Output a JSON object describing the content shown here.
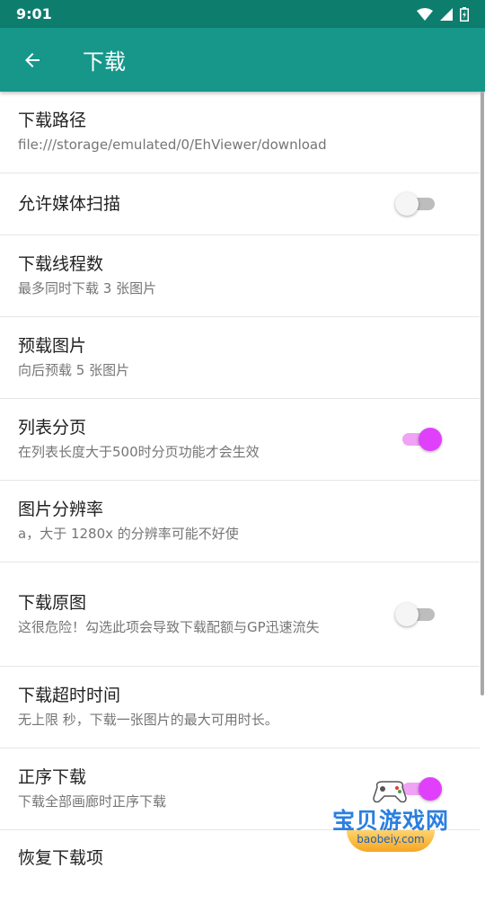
{
  "status_bar": {
    "time": "9:01"
  },
  "app_bar": {
    "title": "下载"
  },
  "settings": [
    {
      "title": "下载路径",
      "subtitle": "file:///storage/emulated/0/EhViewer/download"
    },
    {
      "title": "允许媒体扫描",
      "switch": "off"
    },
    {
      "title": "下载线程数",
      "subtitle": "最多同时下载 3 张图片"
    },
    {
      "title": "预载图片",
      "subtitle": "向后预载 5 张图片"
    },
    {
      "title": "列表分页",
      "subtitle": "在列表长度大于500时分页功能才会生效",
      "switch": "on"
    },
    {
      "title": "图片分辨率",
      "subtitle": "a，大于 1280x 的分辨率可能不好使"
    },
    {
      "title": "下载原图",
      "subtitle": "这很危险！勾选此项会导致下载配额与GP迅速流失",
      "switch": "off"
    },
    {
      "title": "下载超时时间",
      "subtitle": "无上限 秒，下载一张图片的最大可用时长。"
    },
    {
      "title": "正序下载",
      "subtitle": "下载全部画廊时正序下载",
      "switch": "on"
    },
    {
      "title": "恢复下载项"
    }
  ],
  "watermark": {
    "name": "宝贝游戏网",
    "url": "baobeiy.com"
  },
  "colors": {
    "status_bar": "#0d7d6e",
    "app_bar": "#16978a",
    "switch_on": "#e040fb"
  }
}
